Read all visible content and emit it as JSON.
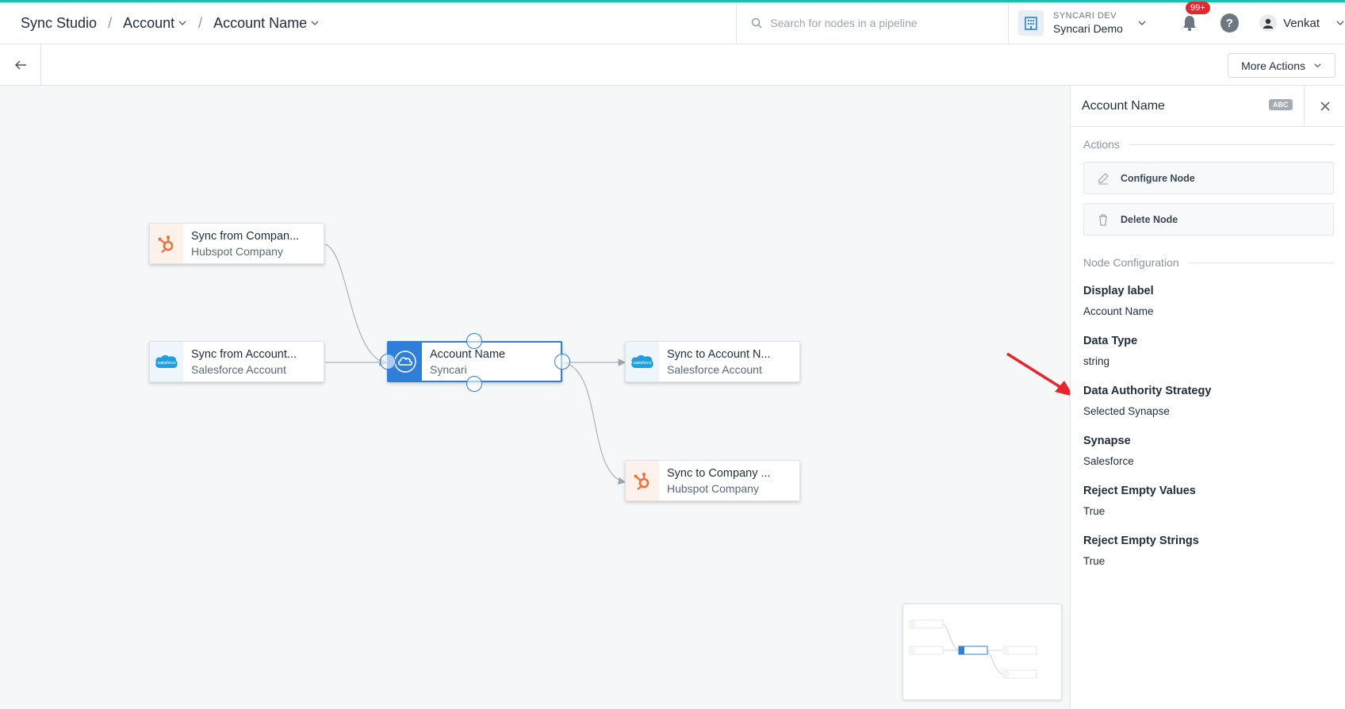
{
  "header": {
    "app_title": "Sync Studio",
    "crumb_entity": "Account",
    "crumb_field": "Account Name",
    "search_placeholder": "Search for nodes in a pipeline",
    "org_env": "SYNCARI DEV",
    "org_name": "Syncari Demo",
    "notification_count": "99+",
    "help_glyph": "?",
    "user_name": "Venkat",
    "accent_color": "#1bbfb0"
  },
  "toolbar": {
    "more_actions_label": "More Actions"
  },
  "canvas": {
    "nodes": [
      {
        "title": "Sync from Compan...",
        "subtitle": "Hubspot Company",
        "icon": "hubspot-icon"
      },
      {
        "title": "Sync from Account...",
        "subtitle": "Salesforce Account",
        "icon": "salesforce-icon"
      },
      {
        "title": "Account Name",
        "subtitle": "Syncari",
        "icon": "syncari-cloud-icon"
      },
      {
        "title": "Sync to Account N...",
        "subtitle": "Salesforce Account",
        "icon": "salesforce-icon"
      },
      {
        "title": "Sync to Company ...",
        "subtitle": "Hubspot Company",
        "icon": "hubspot-icon"
      }
    ],
    "salesforce_logo_text": "salesforce"
  },
  "panel": {
    "title": "Account Name",
    "type_badge": "ABC",
    "actions_heading": "Actions",
    "configure_label": "Configure Node",
    "delete_label": "Delete Node",
    "config_heading": "Node Configuration",
    "fields": [
      {
        "label": "Display label",
        "value": "Account Name"
      },
      {
        "label": "Data Type",
        "value": "string"
      },
      {
        "label": "Data Authority Strategy",
        "value": "Selected Synapse"
      },
      {
        "label": "Synapse",
        "value": "Salesforce"
      },
      {
        "label": "Reject Empty Values",
        "value": "True"
      },
      {
        "label": "Reject Empty Strings",
        "value": "True"
      }
    ]
  }
}
